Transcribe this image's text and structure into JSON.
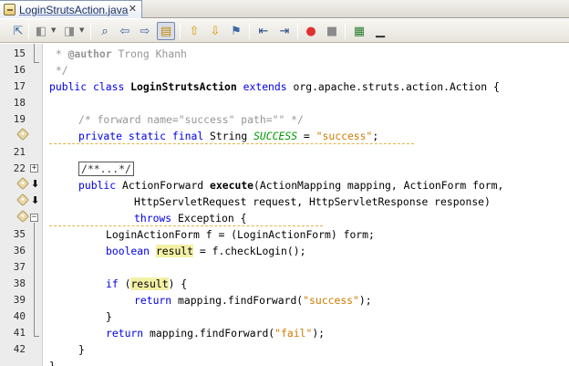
{
  "tab": {
    "title": "LoginStrutsAction.java",
    "close": "✕"
  },
  "toolbar": {
    "buttons": [
      {
        "name": "last-edit-button",
        "glyph": "⇱"
      },
      {
        "name": "back-button",
        "glyph": "◧"
      },
      {
        "name": "forward-button",
        "glyph": "◨"
      },
      {
        "name": "find-selection-button",
        "glyph": "⌕"
      },
      {
        "name": "find-previous-button",
        "glyph": "⇦"
      },
      {
        "name": "find-next-button",
        "glyph": "⇨"
      },
      {
        "name": "toggle-highlight-button",
        "glyph": "▤"
      },
      {
        "name": "previous-bookmark-button",
        "glyph": "⇧"
      },
      {
        "name": "next-bookmark-button",
        "glyph": "⇩"
      },
      {
        "name": "toggle-bookmark-button",
        "glyph": "⚑"
      },
      {
        "name": "shift-left-button",
        "glyph": "⇤"
      },
      {
        "name": "shift-right-button",
        "glyph": "⇥"
      },
      {
        "name": "start-macro-button",
        "glyph": "●"
      },
      {
        "name": "stop-macro-button",
        "glyph": "■"
      },
      {
        "name": "comment-button",
        "glyph": "▦"
      },
      {
        "name": "uncomment-button",
        "glyph": "▁"
      }
    ],
    "colors": {
      "record": "#e03030",
      "stop": "#8a8a8a"
    }
  },
  "gutter": {
    "line_numbers": [
      "15",
      "16",
      "17",
      "18",
      "19",
      "20",
      "21",
      "22",
      "32",
      "33",
      "34",
      "35",
      "36",
      "37",
      "38",
      "39",
      "40",
      "41",
      "42"
    ],
    "fold_collapsed": "+",
    "fold_expanded": "−"
  },
  "code": {
    "l15": {
      "star": " * ",
      "author": "@author",
      "name": " Trong Khanh"
    },
    "l16": " */",
    "l17": {
      "k1": "public",
      "k2": "class",
      "cls": "LoginStrutsAction",
      "k3": "extends",
      "rest": " org.apache.struts.action.Action {"
    },
    "l19": "/* forward name=\"success\" path=\"\" */",
    "l20": {
      "k1": "private",
      "k2": "static",
      "k3": "final",
      "type": " String ",
      "const": "SUCCESS",
      "eq": " = ",
      "str": "\"success\"",
      "end": ";"
    },
    "l22": "/**...*/",
    "l32": {
      "k1": "public",
      "type": " ActionForward ",
      "method": "execute",
      "rest": "(ActionMapping mapping, ActionForm form,"
    },
    "l33": "HttpServletRequest request, HttpServletResponse response)",
    "l34": {
      "k1": "throws",
      "rest": " Exception {"
    },
    "l35": "LoginActionForm f = (LoginActionForm) form;",
    "l36": {
      "k1": "boolean",
      "var": "result",
      "rest": " = f.checkLogin();"
    },
    "l38": {
      "k1": "if",
      "open": " (",
      "var": "result",
      "rest": ") {"
    },
    "l39": {
      "k1": "return",
      "pre": " mapping.findForward(",
      "str": "\"success\"",
      "end": ");"
    },
    "l40": "}",
    "l41": {
      "k1": "return",
      "pre": " mapping.findForward(",
      "str": "\"fail\"",
      "end": ");"
    },
    "l42": "}",
    "l43": "}"
  }
}
